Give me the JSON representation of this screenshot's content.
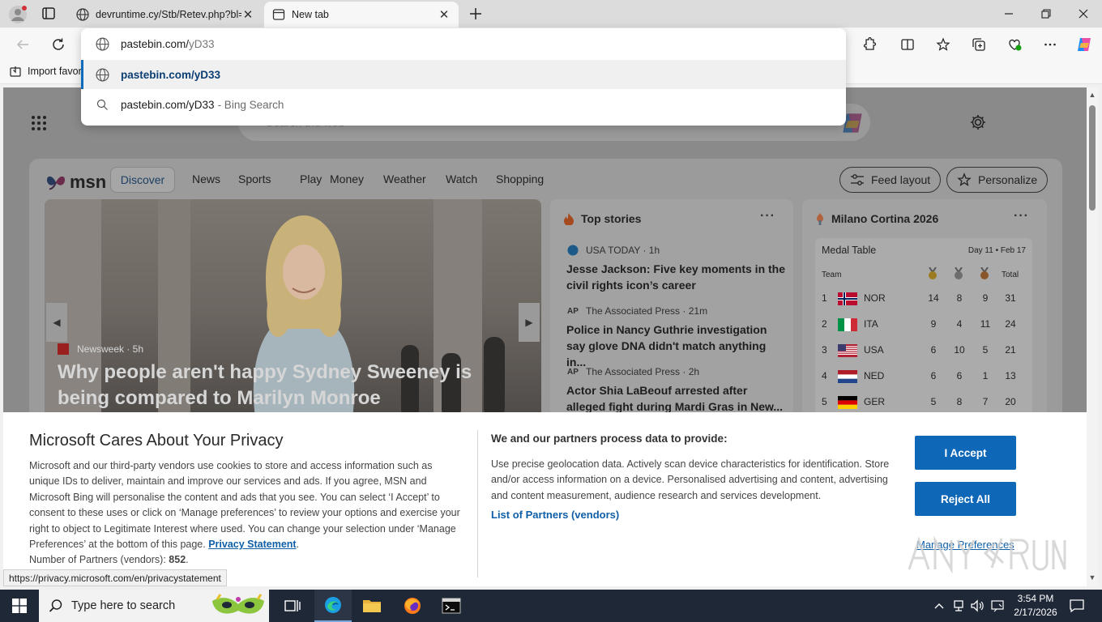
{
  "browser": {
    "tabs": [
      {
        "title": "devruntime.cy/Stb/Retev.php?bl=",
        "active": false
      },
      {
        "title": "New tab",
        "active": true
      }
    ],
    "favorites_bar": {
      "import_label": "Import favor"
    }
  },
  "omnibox": {
    "typed": "pastebin.com/",
    "typed_autocomplete": "yD33",
    "suggestions": [
      {
        "text": "pastebin.com/yD33",
        "icon": "globe-icon",
        "selected": true
      },
      {
        "text": "pastebin.com/yD33",
        "suffix": "- Bing Search",
        "icon": "search-icon",
        "selected": false
      }
    ]
  },
  "newtab": {
    "search_placeholder": "Search the web",
    "msn": {
      "logo": "msn",
      "nav": [
        "Discover",
        "News",
        "Sports",
        "Play",
        "Money",
        "Weather",
        "Watch",
        "Shopping"
      ],
      "feed_layout": "Feed layout",
      "personalize": "Personalize",
      "hero": {
        "source": "Newsweek · 5h",
        "title": "Why people aren't happy Sydney Sweeney is being compared to Marilyn Monroe"
      },
      "top_stories": {
        "title": "Top stories",
        "more": "···",
        "items": [
          {
            "source": "USA TODAY · 1h",
            "logo": "usa-today-logo",
            "headline": "Jesse Jackson: Five key moments in the civil rights icon’s career"
          },
          {
            "source": "The Associated Press · 21m",
            "logo": "AP",
            "headline": "Police in Nancy Guthrie investigation say glove DNA didn't match anything in..."
          },
          {
            "source": "The Associated Press · 2h",
            "logo": "AP",
            "headline": "Actor Shia LaBeouf arrested after alleged fight during Mardi Gras in New..."
          }
        ]
      },
      "olympics": {
        "title": "Milano Cortina 2026",
        "more": "···",
        "medal_table": "Medal Table",
        "day": "Day 11 • Feb 17",
        "col_team": "Team",
        "col_total": "Total",
        "rows": [
          {
            "rank": "1",
            "team": "NOR",
            "gold": "14",
            "silver": "8",
            "bronze": "9",
            "total": "31"
          },
          {
            "rank": "2",
            "team": "ITA",
            "gold": "9",
            "silver": "4",
            "bronze": "11",
            "total": "24"
          },
          {
            "rank": "3",
            "team": "USA",
            "gold": "6",
            "silver": "10",
            "bronze": "5",
            "total": "21"
          },
          {
            "rank": "4",
            "team": "NED",
            "gold": "6",
            "silver": "6",
            "bronze": "1",
            "total": "13"
          },
          {
            "rank": "5",
            "team": "GER",
            "gold": "5",
            "silver": "8",
            "bronze": "7",
            "total": "20"
          }
        ]
      }
    }
  },
  "consent": {
    "title": "Microsoft Cares About Your Privacy",
    "body": "Microsoft and our third-party vendors use cookies to store and access information such as unique IDs to deliver, maintain and improve our services and ads. If you agree, MSN and Microsoft Bing will personalise the content and ads that you see. You can select ‘I Accept’ to consent to these uses or click on ‘Manage preferences’ to review your options and exercise your right to object to Legitimate Interest where used.  You can change your selection under ‘Manage Preferences’ at the bottom of this page.",
    "privacy_link": "Privacy Statement",
    "partners_label": "Number of Partners (vendors):",
    "partners_count": "852",
    "subtitle": "We and our partners process data to provide:",
    "body2": "Use precise geolocation data. Actively scan device characteristics for identification. Store and/or access information on a device. Personalised advertising and content, advertising and content measurement, audience research and services development.",
    "partners_link": "List of Partners (vendors)",
    "accept": "I Accept",
    "reject": "Reject All",
    "manage": "Manage Preferences"
  },
  "status_url": "https://privacy.microsoft.com/en/privacystatement",
  "taskbar": {
    "search_placeholder": "Type here to search",
    "time": "3:54 PM",
    "date": "2/17/2026"
  },
  "colors": {
    "accent": "#0f67b8",
    "link": "#0f5fa8",
    "taskbar": "#1f2836"
  }
}
